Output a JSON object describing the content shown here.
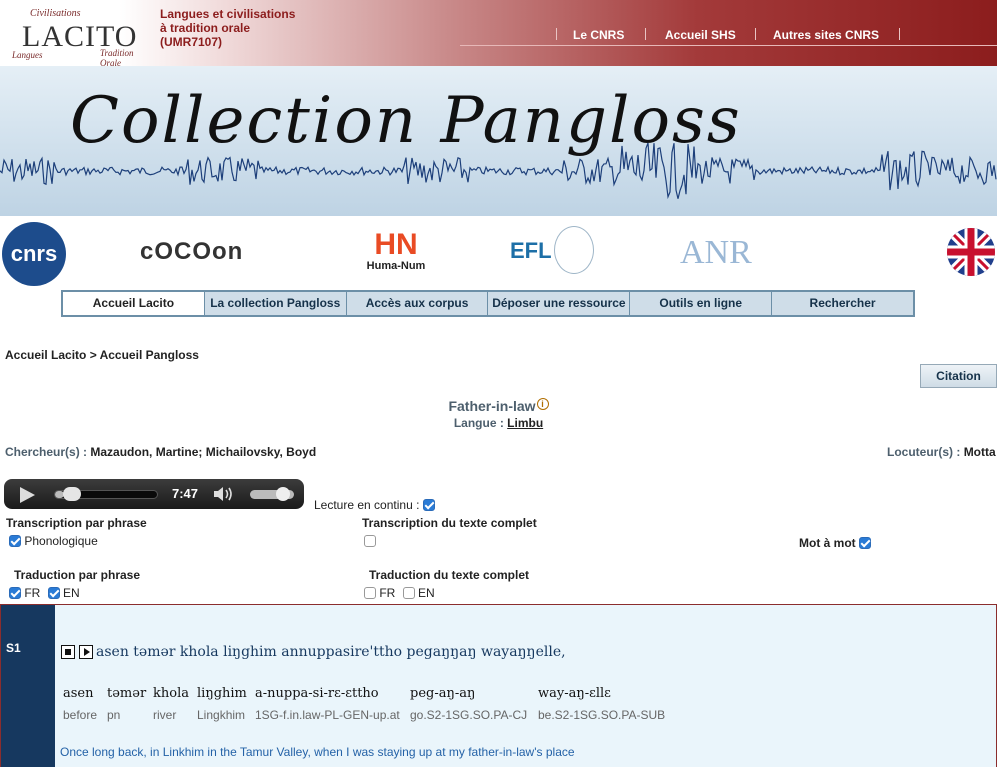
{
  "header": {
    "logo_text": "LACITO",
    "logo_arc_top": "Civilisations",
    "logo_arc_left": "Langues",
    "logo_arc_right": "Tradition Orale",
    "lab_line1": "Langues et civilisations",
    "lab_line2": "à tradition orale",
    "lab_line3": "(UMR7107)",
    "links": [
      "Le CNRS",
      "Accueil SHS",
      "Autres sites CNRS"
    ]
  },
  "banner": {
    "title": "Collection Pangloss"
  },
  "partners": {
    "cnrs": "cnrs",
    "cocoon": "cOCOon",
    "humanum_mark": "HN",
    "humanum": "Huma-Num",
    "efl": "EFL",
    "anr": "ANR"
  },
  "nav": {
    "items": [
      "Accueil Lacito",
      "La collection Pangloss",
      "Accès aux corpus",
      "Déposer une ressource",
      "Outils en ligne",
      "Rechercher"
    ]
  },
  "breadcrumb": "Accueil Lacito > Accueil Pangloss",
  "citation_label": "Citation",
  "document": {
    "title": "Father-in-law",
    "info_glyph": "i",
    "langue_label": "Langue :",
    "langue_value": "Limbu",
    "researchers_label": "Chercheur(s) :",
    "researchers_value": "Mazaudon, Martine; Michailovsky, Boyd",
    "speakers_label": "Locuteur(s) :",
    "speakers_value": "Motta"
  },
  "player": {
    "time": "7:47",
    "progress": 0.09,
    "volume": 0.75
  },
  "options": {
    "continuous_label": "Lecture en continu :",
    "continuous_checked": true,
    "transcription_phrase": "Transcription par phrase",
    "phonologique": "Phonologique",
    "phonologique_checked": true,
    "transcription_full": "Transcription du texte complet",
    "transcription_full_checked": false,
    "word_by_word": "Mot à mot",
    "word_by_word_checked": true,
    "translation_phrase": "Traduction par phrase",
    "translation_full": "Traduction du texte complet",
    "fr": "FR",
    "en": "EN",
    "phrase_fr_checked": true,
    "phrase_en_checked": true,
    "full_fr_checked": false,
    "full_en_checked": false
  },
  "sentence": {
    "id": "S1",
    "transcription": "asen təmər khola liŋghim annuppasire'ttho pegaŋŋaŋ wayaŋŋelle,",
    "words": [
      {
        "form": "asen",
        "gloss": "before"
      },
      {
        "form": "təmər",
        "gloss": "pn"
      },
      {
        "form": "khola",
        "gloss": "river"
      },
      {
        "form": "liŋghim",
        "gloss": "Lingkhim"
      },
      {
        "form": "a-nuppa-si-rɛ-ɛttho",
        "gloss": "1SG-f.in.law-PL-GEN-up.at"
      },
      {
        "form": "peg-aŋ-aŋ",
        "gloss": "go.S2-1SG.SO.PA-CJ"
      },
      {
        "form": "way-aŋ-ɛllɛ",
        "gloss": "be.S2-1SG.SO.PA-SUB"
      }
    ],
    "translation": "Once long back, in Linkhim in the Tamur Valley, when I was staying up at my father-in-law's place"
  }
}
